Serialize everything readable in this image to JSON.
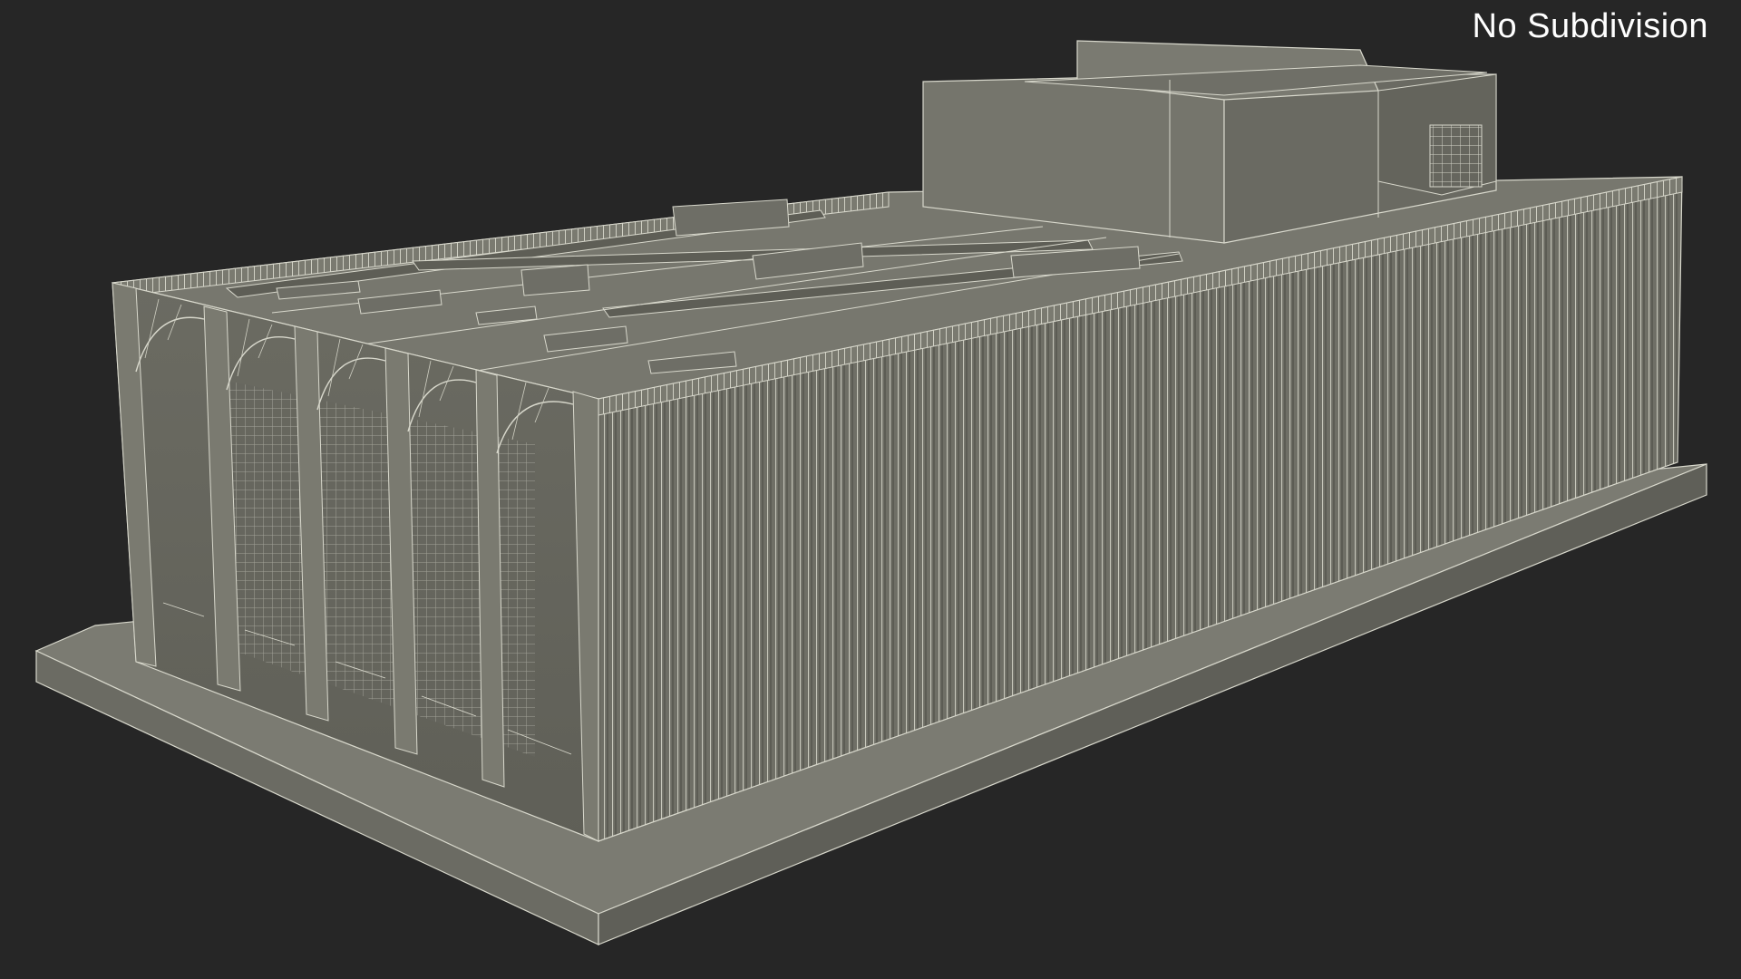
{
  "viewport": {
    "label": "No Subdivision",
    "background": "#262626",
    "model_surface_color": "#6f6f66",
    "wireframe_color": "#d8d8cc"
  }
}
